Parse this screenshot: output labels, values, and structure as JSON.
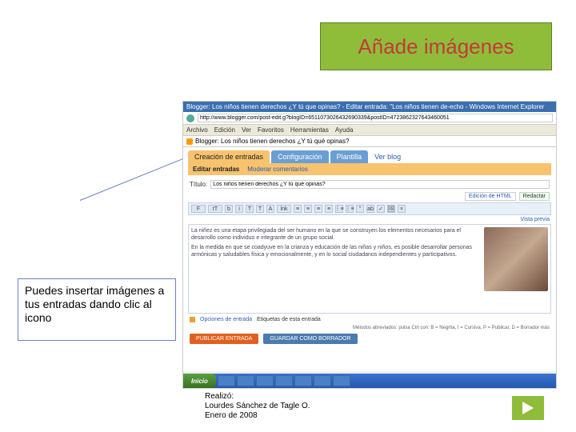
{
  "title": "Añade imágenes",
  "callout": "Puedes insertar imágenes a tus entradas dando clic al icono",
  "ie": {
    "window_title": "Blogger: Los niños tienen derechos ¿Y tú que opinas? - Editar entrada: \"Los niños tienen de-echo - Windows Internet Explorer",
    "url": "http://www.blogger.com/post-edit.g?blogID=6511073026432690339&postID=4723862327643460051",
    "menu": [
      "Archivo",
      "Edición",
      "Ver",
      "Favoritos",
      "Herramientas",
      "Ayuda"
    ],
    "tab": "Blogger: Los niños tienen derechos ¿Y tú qué opinas?"
  },
  "blogger": {
    "tabs": [
      "Creación de entradas",
      "Configuración",
      "Plantilla",
      "Ver blog"
    ],
    "subtabs": [
      "Editar entradas",
      "Moderar comentarios"
    ],
    "titulo_label": "Título:",
    "titulo_value": "Los niños tienen derechos ¿Y tú qué opinas?",
    "mode_html": "Edición de HTML",
    "mode_redactar": "Redactar",
    "preview": "Vista previa",
    "toolbar_items": [
      "F",
      "tT",
      "b",
      "i",
      "T",
      "T",
      "A",
      "lnk",
      "≡",
      "≡",
      "≡",
      "≡",
      "⋮≡",
      "⋮≡",
      "\"",
      "ab",
      "✓",
      "🖼",
      "×"
    ],
    "editor_p1": "La niñez es una etapa privilegiada del ser humano en la que se construyen los elementos necesarios para el desarrollo como individuo e integrante de un grupo social.",
    "editor_p2": "En la medida en que se coadyuve en la crianza y educación de las niñas y niños, es posible desarrollar personas armónicas y saludables física y emocionalmente, y en lo social ciudadanos independientes y participativos.",
    "options_label": "Opciones de entrada",
    "options_text": "Etiquetas de esta entrada",
    "shortcuts": "Métodos abreviados: pulsa Ctrl con: B = Negrita, I = Cursiva, P = Publicar, D = Borrador más",
    "btn_publish": "PUBLICAR ENTRADA",
    "btn_save": "GUARDAR COMO BORRADOR"
  },
  "taskbar": {
    "start": "Inicio"
  },
  "credits": {
    "l1": "Realizó:",
    "l2": "Lourdes Sánchez de Tagle O.",
    "l3": "Enero de 2008"
  }
}
